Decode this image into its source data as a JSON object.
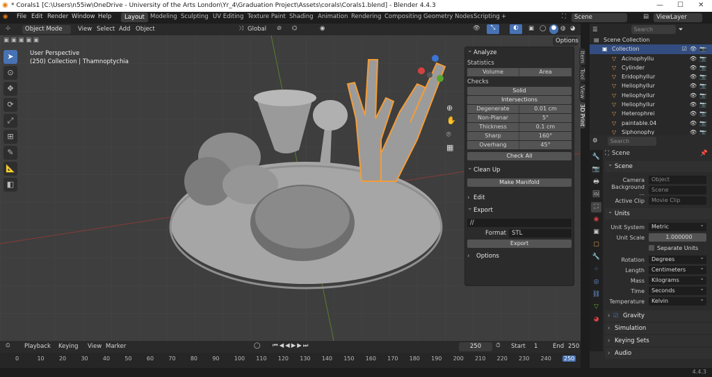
{
  "title": "* Corals1 [C:\\Users\\n55iw\\OneDrive - University of the Arts London\\Yr_4\\Graduation Project\\Assets\\corals\\Corals1.blend] - Blender 4.4.3",
  "menu": [
    "File",
    "Edit",
    "Render",
    "Window",
    "Help"
  ],
  "workspaces": [
    "Layout",
    "Modeling",
    "Sculpting",
    "UV Editing",
    "Texture Paint",
    "Shading",
    "Animation",
    "Rendering",
    "Compositing",
    "Geometry Nodes",
    "Scripting",
    "+"
  ],
  "scene_field": "Scene",
  "viewlayer_field": "ViewLayer",
  "vp_header": {
    "mode": "Object Mode",
    "view": "View",
    "select": "Select",
    "add": "Add",
    "object": "Object",
    "orientation": "Global",
    "options": "Options"
  },
  "overlay": {
    "perspective": "User Perspective",
    "collection": "(250) Collection | Thamnoptychia"
  },
  "npanel": {
    "analyze": "Analyze",
    "statistics": "Statistics",
    "volume": "Volume",
    "area": "Area",
    "checks": "Checks",
    "solid": "Solid",
    "intersections": "Intersections",
    "rows": [
      {
        "k": "Degenerate",
        "v": "0.01 cm"
      },
      {
        "k": "Non-Planar",
        "v": "5°"
      },
      {
        "k": "Thickness",
        "v": "0.1 cm"
      },
      {
        "k": "Sharp",
        "v": "160°"
      },
      {
        "k": "Overhang",
        "v": "45°"
      }
    ],
    "check_all": "Check All",
    "cleanup": "Clean Up",
    "make_manifold": "Make Manifold",
    "edit": "Edit",
    "export": "Export",
    "path": "//",
    "format_label": "Format",
    "format_value": "STL",
    "export_btn": "Export",
    "options": "Options"
  },
  "sidetabs": [
    "Item",
    "Tool",
    "View",
    "3D Print"
  ],
  "outliner": {
    "search": "Search",
    "scene_collection": "Scene Collection",
    "collection": "Collection",
    "items": [
      "Acinophyllu",
      "Cylinder",
      "Eridophyllur",
      "Heliophyllur",
      "Heliophyllur",
      "Heliophyllur",
      "Heterophrei",
      "paintable.04",
      "Siphonophy"
    ]
  },
  "props": {
    "search": "Search",
    "scene_title": "Scene",
    "scene": "Scene",
    "camera_l": "Camera",
    "camera_v": "Object",
    "bg_l": "Background ...",
    "bg_v": "Scene",
    "clip_l": "Active Clip",
    "clip_v": "Movie Clip",
    "units": "Units",
    "unit_system_l": "Unit System",
    "unit_system_v": "Metric",
    "unit_scale_l": "Unit Scale",
    "unit_scale_v": "1.000000",
    "separate_units": "Separate Units",
    "rotation_l": "Rotation",
    "rotation_v": "Degrees",
    "length_l": "Length",
    "length_v": "Centimeters",
    "mass_l": "Mass",
    "mass_v": "Kilograms",
    "time_l": "Time",
    "time_v": "Seconds",
    "temp_l": "Temperature",
    "temp_v": "Kelvin",
    "gravity": "Gravity",
    "simulation": "Simulation",
    "keying_sets": "Keying Sets",
    "audio": "Audio"
  },
  "timeline": {
    "playback": "Playback",
    "keying": "Keying",
    "view": "View",
    "marker": "Marker",
    "current": "250",
    "start_l": "Start",
    "start_v": "1",
    "end_l": "End",
    "end_v": "250",
    "ticks": [
      "0",
      "10",
      "20",
      "30",
      "40",
      "50",
      "60",
      "70",
      "80",
      "90",
      "100",
      "110",
      "120",
      "130",
      "140",
      "150",
      "160",
      "170",
      "180",
      "190",
      "200",
      "210",
      "220",
      "230",
      "240",
      "250"
    ]
  },
  "version": "4.4.3"
}
